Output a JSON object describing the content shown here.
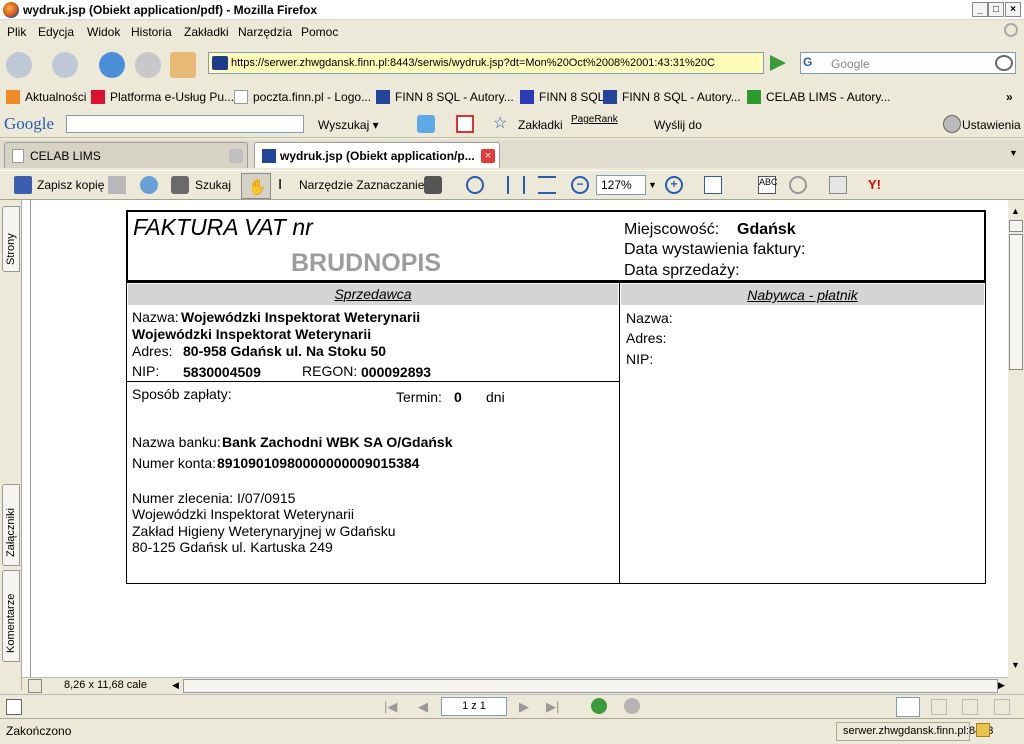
{
  "window": {
    "title": "wydruk.jsp (Obiekt application/pdf) - Mozilla Firefox"
  },
  "menu": [
    "Plik",
    "Edycja",
    "Widok",
    "Historia",
    "Zakładki",
    "Narzędzia",
    "Pomoc"
  ],
  "nav": {
    "url": "https://serwer.zhwgdansk.finn.pl:8443/serwis/wydruk.jsp?dt=Mon%20Oct%2008%2001:43:31%20C",
    "search_placeholder": "Google"
  },
  "bookmarks": [
    "Aktualności",
    "Platforma e-Usług Pu...",
    "poczta.finn.pl - Logo...",
    "FINN 8 SQL - Autory...",
    "FINN 8 SQL",
    "FINN 8 SQL - Autory...",
    "CELAB LIMS - Autory..."
  ],
  "google_toolbar": {
    "logo": "Google",
    "search": "Wyszukaj",
    "bookmarks": "Zakładki",
    "pagerank": "PageRank",
    "send": "Wyślij do",
    "settings": "Ustawienia"
  },
  "tabs": [
    {
      "label": "CELAB LIMS"
    },
    {
      "label": "wydruk.jsp (Obiekt application/p..."
    }
  ],
  "pdf_toolbar": {
    "save": "Zapisz kopię",
    "search": "Szukaj",
    "select_tool": "Narzędzie Zaznaczanie",
    "zoom": "127%"
  },
  "side_tabs": [
    "Strony",
    "Załączniki",
    "Komentarze"
  ],
  "page_size": "8,26 x 11,68 cale",
  "page_nav": "1 z 1",
  "status": {
    "left": "Zakończono",
    "right": "serwer.zhwgdansk.finn.pl:8443"
  },
  "invoice": {
    "title": "FAKTURA VAT nr",
    "draft": "BRUDNOPIS",
    "place_label": "Miejscowość:",
    "place": "Gdańsk",
    "issue_label": "Data wystawienia faktury:",
    "sale_label": "Data sprzedaży:",
    "seller_header": "Sprzedawca",
    "buyer_header": "Nabywca - płatnik",
    "name_label": "Nazwa:",
    "seller_name1": "Wojewódzki Inspektorat Weterynarii",
    "seller_name2": "Wojewódzki Inspektorat Weterynarii",
    "addr_label": "Adres:",
    "seller_addr": "80-958 Gdańsk ul. Na Stoku 50",
    "nip_label": "NIP:",
    "nip": "5830004509",
    "regon_label": "REGON:",
    "regon": "000092893",
    "payment_label": "Sposób zapłaty:",
    "term_label": "Termin:",
    "term": "0",
    "term_unit": "dni",
    "bank_label": "Nazwa banku:",
    "bank": "Bank Zachodni WBK SA O/Gdańsk",
    "account_label": "Numer konta:",
    "account": "89109010980000000009015384",
    "order": "Numer zlecenia: I/07/0915",
    "recipient": [
      "Wojewódzki Inspektorat Weterynarii",
      "Zakład Higieny Weterynaryjnej w Gdańsku",
      "80-125 Gdańsk ul. Kartuska 249"
    ],
    "buyer_name_label": "Nazwa:",
    "buyer_addr_label": "Adres:",
    "buyer_nip_label": "NIP:"
  }
}
